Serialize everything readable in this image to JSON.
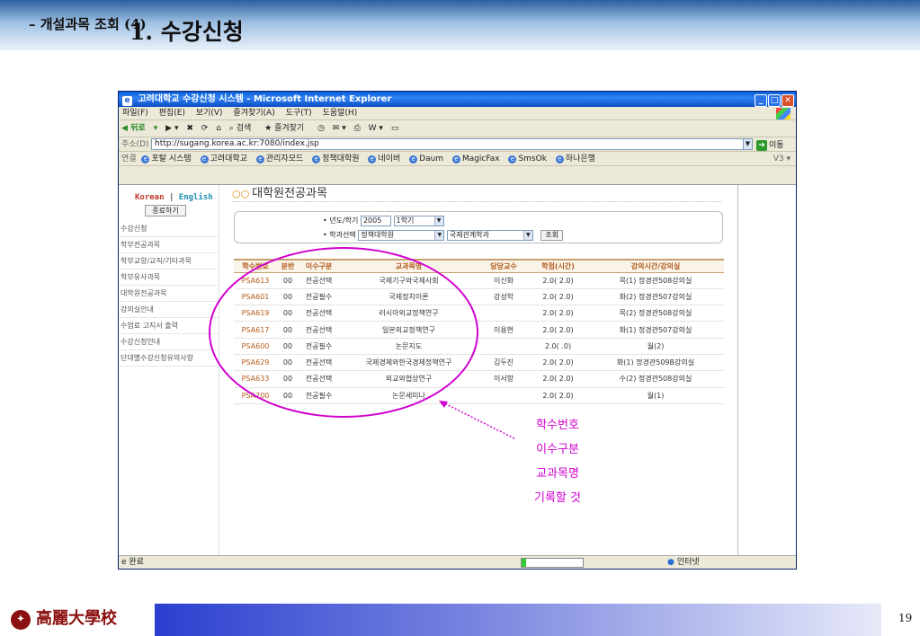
{
  "slide": {
    "title_main": "1. 수강신청",
    "title_sub": "– 개설과목 조회 (4)",
    "logo_text": "高麗大學校",
    "page_number": "19"
  },
  "browser": {
    "window_title": "고려대학교 수강신청 시스템 - Microsoft Internet Explorer",
    "menu": [
      "파일(F)",
      "편집(E)",
      "보기(V)",
      "즐겨찾기(A)",
      "도구(T)",
      "도움말(H)"
    ],
    "toolbar": {
      "back": "뒤로",
      "search": "검색",
      "favorites": "즐겨찾기"
    },
    "address_label": "주소(D)",
    "url": "http://sugang.korea.ac.kr:7080/index.jsp",
    "go_label": "이동",
    "links_label": "연결",
    "links": [
      "포탈 시스템",
      "고려대학교",
      "관리자모드",
      "정책대학원",
      "네이버",
      "Daum",
      "MagicFax",
      "SmsOk",
      "하나은행"
    ],
    "links_right": "V3",
    "status_text": "완료",
    "status_zone": "인터넷",
    "progress": 0.07
  },
  "left_nav": {
    "lang_korean": "Korean",
    "lang_sep": "|",
    "lang_english": "English",
    "logout": "종료하기",
    "items": [
      "수강신청",
      "학부전공과목",
      "학부교양/교직/기타과목",
      "학부유사과목",
      "대학원전공과목",
      "강의실안내",
      "수업료 고지서 출력",
      "수강신청안내",
      "단대별수강신청유의사항"
    ]
  },
  "main": {
    "heading_icon": "○○",
    "heading": "대학원전공과목",
    "year_label": "• 년도/학기",
    "year_value": "2005",
    "term_value": "1학기",
    "dept_label": "• 학과선택",
    "grad_school_value": "정책대학원",
    "dept_value": "국제관계학과",
    "search_button": "조회",
    "columns": [
      "학수번호",
      "분반",
      "이수구분",
      "교과목명",
      "담당교수",
      "학점(시간)",
      "강의시간/강의실"
    ],
    "rows": [
      [
        "PSA613",
        "00",
        "전공선택",
        "국제기구와국제사회",
        "이신화",
        "2.0( 2.0)",
        "목(1) 정경관508강의실"
      ],
      [
        "PSA601",
        "00",
        "전공필수",
        "국제정치이론",
        "강성학",
        "2.0( 2.0)",
        "화(2) 정경관507강의실"
      ],
      [
        "PSA619",
        "00",
        "전공선택",
        "러시아외교정책연구",
        "",
        "2.0( 2.0)",
        "목(2) 정경관508강의실"
      ],
      [
        "PSA617",
        "00",
        "전공선택",
        "일본외교정책연구",
        "이용현",
        "2.0( 2.0)",
        "화(1) 정경관507강의실"
      ],
      [
        "PSA600",
        "00",
        "전공필수",
        "논문지도",
        "",
        "2.0( .0)",
        "월(2)"
      ],
      [
        "PSA629",
        "00",
        "전공선택",
        "국제경제와한국경제정책연구",
        "김두진",
        "2.0( 2.0)",
        "화(1) 정경관509B강의실"
      ],
      [
        "PSA633",
        "00",
        "전공선택",
        "외교와협상연구",
        "이서항",
        "2.0( 2.0)",
        "수(2) 정경관508강의실"
      ],
      [
        "PSA700",
        "00",
        "전공필수",
        "논문세미나",
        "",
        "2.0( 2.0)",
        "월(1)"
      ]
    ]
  },
  "annotation": [
    "학수번호",
    "이수구분",
    "교과목명",
    "기록할 것"
  ],
  "colors": {
    "annotation": "#d000d0",
    "course_code": "#b85c1a",
    "header_text": "#b05a1a"
  }
}
